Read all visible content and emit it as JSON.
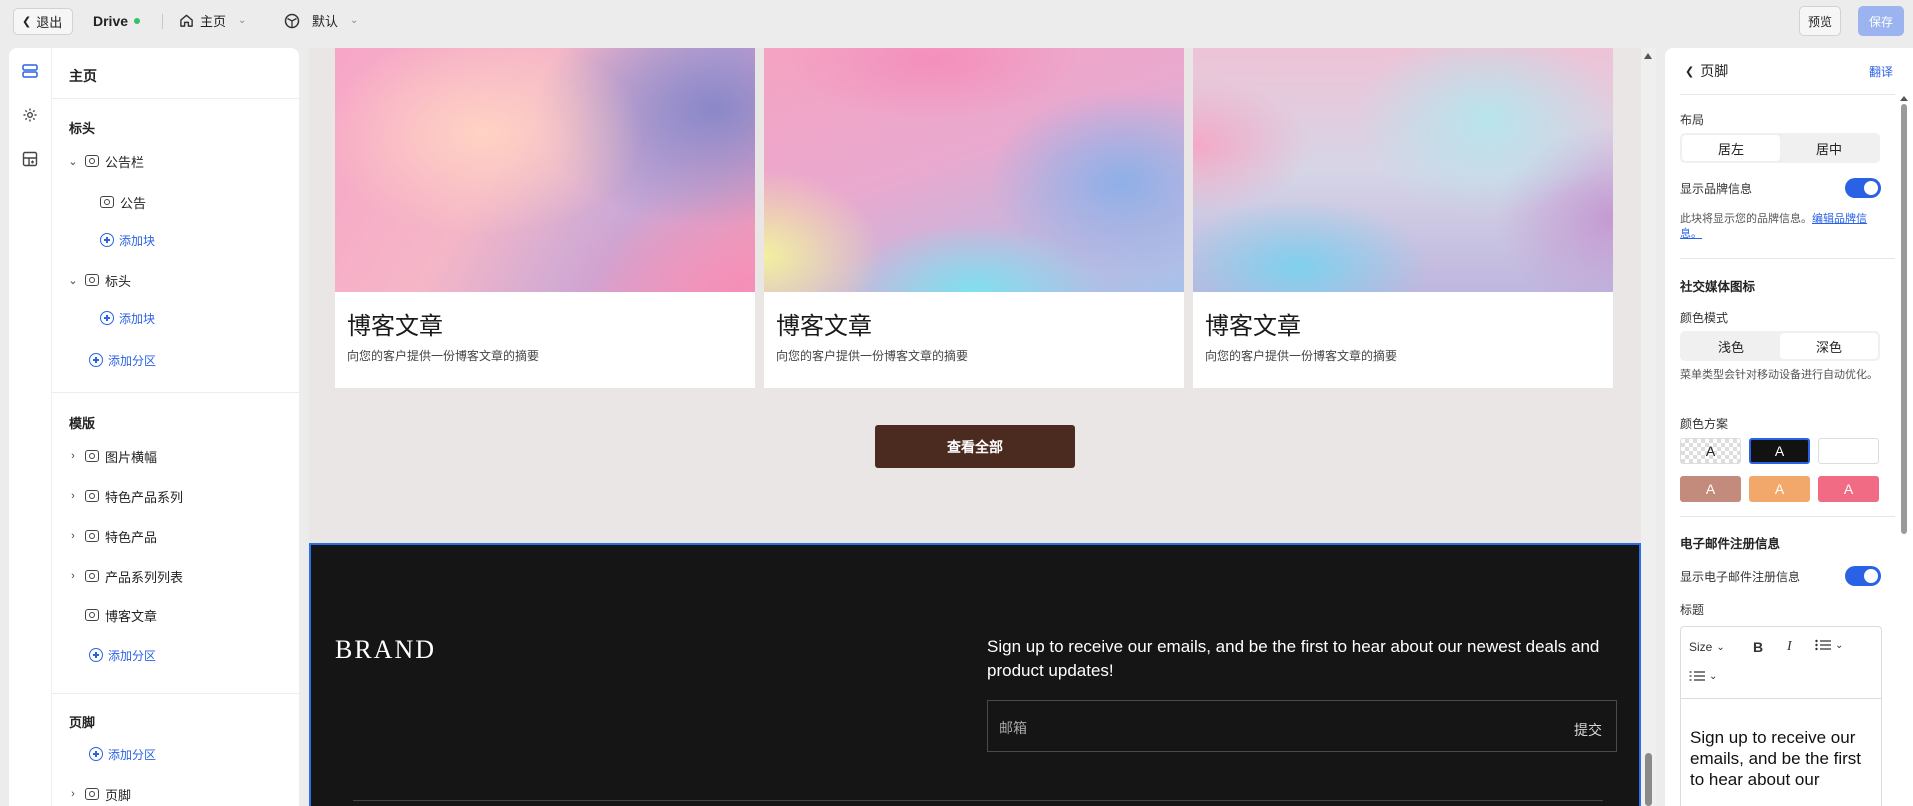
{
  "topbar": {
    "exit_label": "退出",
    "app_name": "Drive",
    "status_color": "#2ec26b",
    "page_selector": "主页",
    "theme_selector": "默认",
    "preview_label": "预览",
    "save_label": "保存"
  },
  "rail": {
    "icons": [
      "sections-icon",
      "settings-icon",
      "blocks-icon"
    ]
  },
  "tree": {
    "title": "主页",
    "header_section": "标头",
    "announcement_bar": "公告栏",
    "announcement": "公告",
    "add_block": "添加块",
    "header": "标头",
    "add_block_2": "添加块",
    "add_section": "添加分区",
    "template_section": "模版",
    "template_items": [
      "图片横幅",
      "特色产品系列",
      "特色产品",
      "产品系列列表",
      "博客文章"
    ],
    "add_section_2": "添加分区",
    "footer_section": "页脚",
    "add_section_3": "添加分区",
    "footer": "页脚"
  },
  "canvas": {
    "cards": [
      {
        "title": "博客文章",
        "desc": "向您的客户提供一份博客文章的摘要"
      },
      {
        "title": "博客文章",
        "desc": "向您的客户提供一份博客文章的摘要"
      },
      {
        "title": "博客文章",
        "desc": "向您的客户提供一份博客文章的摘要"
      }
    ],
    "view_all": "查看全部",
    "footer": {
      "brand": "BRAND",
      "signup_text": "Sign up to receive our emails, and be the first to hear about our newest deals and product updates!",
      "email_placeholder": "邮箱",
      "submit": "提交"
    }
  },
  "panel": {
    "back_title": "页脚",
    "translate": "翻译",
    "layout_label": "布局",
    "layout_options": [
      "居左",
      "居中"
    ],
    "layout_selected": "居中",
    "show_brand_label": "显示品牌信息",
    "show_brand_on": true,
    "brand_note": "此块将显示您的品牌信息。",
    "brand_note_link": "编辑品牌信息。",
    "social_heading": "社交媒体图标",
    "color_mode_label": "颜色模式",
    "color_mode_options": [
      "浅色",
      "深色"
    ],
    "color_mode_selected": "深色",
    "color_mode_note": "菜单类型会针对移动设备进行自动优化。",
    "scheme_label": "颜色方案",
    "swatches": [
      {
        "letter": "A",
        "color": "transparent"
      },
      {
        "letter": "A",
        "color": "#121212",
        "selected": true
      },
      {
        "letter": "A",
        "color": "#ffffff"
      },
      {
        "letter": "A",
        "color": "#c38b7b"
      },
      {
        "letter": "A",
        "color": "#f2a86b"
      },
      {
        "letter": "A",
        "color": "#f06b83"
      }
    ],
    "email_heading": "电子邮件注册信息",
    "show_email_label": "显示电子邮件注册信息",
    "show_email_on": true,
    "title_label": "标题",
    "toolbar": {
      "size": "Size",
      "bold": "B",
      "italic": "I"
    },
    "editor_text": "Sign up to receive our emails, and be the first to hear about our"
  },
  "colors": {
    "accent": "#2a62e6",
    "footer_bg": "#151515",
    "button_brown": "#4b2a20"
  }
}
